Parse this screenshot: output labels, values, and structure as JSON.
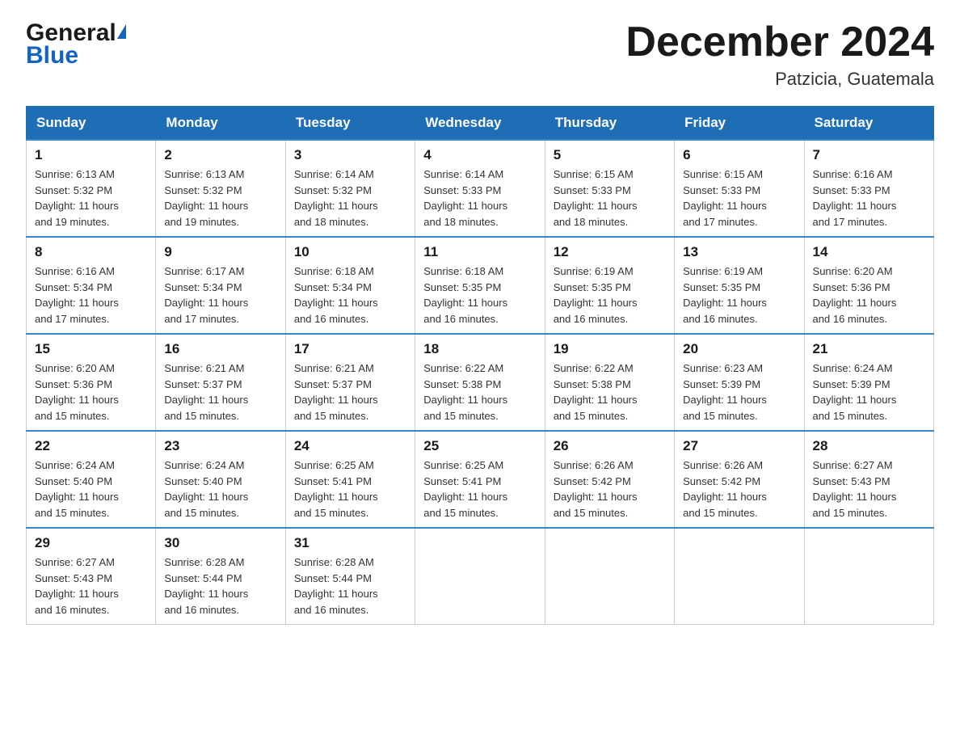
{
  "header": {
    "logo_general": "General",
    "logo_blue": "Blue",
    "month_title": "December 2024",
    "location": "Patzicia, Guatemala"
  },
  "calendar": {
    "days_of_week": [
      "Sunday",
      "Monday",
      "Tuesday",
      "Wednesday",
      "Thursday",
      "Friday",
      "Saturday"
    ],
    "weeks": [
      [
        {
          "day": "1",
          "sunrise": "6:13 AM",
          "sunset": "5:32 PM",
          "daylight": "11 hours and 19 minutes."
        },
        {
          "day": "2",
          "sunrise": "6:13 AM",
          "sunset": "5:32 PM",
          "daylight": "11 hours and 19 minutes."
        },
        {
          "day": "3",
          "sunrise": "6:14 AM",
          "sunset": "5:32 PM",
          "daylight": "11 hours and 18 minutes."
        },
        {
          "day": "4",
          "sunrise": "6:14 AM",
          "sunset": "5:33 PM",
          "daylight": "11 hours and 18 minutes."
        },
        {
          "day": "5",
          "sunrise": "6:15 AM",
          "sunset": "5:33 PM",
          "daylight": "11 hours and 18 minutes."
        },
        {
          "day": "6",
          "sunrise": "6:15 AM",
          "sunset": "5:33 PM",
          "daylight": "11 hours and 17 minutes."
        },
        {
          "day": "7",
          "sunrise": "6:16 AM",
          "sunset": "5:33 PM",
          "daylight": "11 hours and 17 minutes."
        }
      ],
      [
        {
          "day": "8",
          "sunrise": "6:16 AM",
          "sunset": "5:34 PM",
          "daylight": "11 hours and 17 minutes."
        },
        {
          "day": "9",
          "sunrise": "6:17 AM",
          "sunset": "5:34 PM",
          "daylight": "11 hours and 17 minutes."
        },
        {
          "day": "10",
          "sunrise": "6:18 AM",
          "sunset": "5:34 PM",
          "daylight": "11 hours and 16 minutes."
        },
        {
          "day": "11",
          "sunrise": "6:18 AM",
          "sunset": "5:35 PM",
          "daylight": "11 hours and 16 minutes."
        },
        {
          "day": "12",
          "sunrise": "6:19 AM",
          "sunset": "5:35 PM",
          "daylight": "11 hours and 16 minutes."
        },
        {
          "day": "13",
          "sunrise": "6:19 AM",
          "sunset": "5:35 PM",
          "daylight": "11 hours and 16 minutes."
        },
        {
          "day": "14",
          "sunrise": "6:20 AM",
          "sunset": "5:36 PM",
          "daylight": "11 hours and 16 minutes."
        }
      ],
      [
        {
          "day": "15",
          "sunrise": "6:20 AM",
          "sunset": "5:36 PM",
          "daylight": "11 hours and 15 minutes."
        },
        {
          "day": "16",
          "sunrise": "6:21 AM",
          "sunset": "5:37 PM",
          "daylight": "11 hours and 15 minutes."
        },
        {
          "day": "17",
          "sunrise": "6:21 AM",
          "sunset": "5:37 PM",
          "daylight": "11 hours and 15 minutes."
        },
        {
          "day": "18",
          "sunrise": "6:22 AM",
          "sunset": "5:38 PM",
          "daylight": "11 hours and 15 minutes."
        },
        {
          "day": "19",
          "sunrise": "6:22 AM",
          "sunset": "5:38 PM",
          "daylight": "11 hours and 15 minutes."
        },
        {
          "day": "20",
          "sunrise": "6:23 AM",
          "sunset": "5:39 PM",
          "daylight": "11 hours and 15 minutes."
        },
        {
          "day": "21",
          "sunrise": "6:24 AM",
          "sunset": "5:39 PM",
          "daylight": "11 hours and 15 minutes."
        }
      ],
      [
        {
          "day": "22",
          "sunrise": "6:24 AM",
          "sunset": "5:40 PM",
          "daylight": "11 hours and 15 minutes."
        },
        {
          "day": "23",
          "sunrise": "6:24 AM",
          "sunset": "5:40 PM",
          "daylight": "11 hours and 15 minutes."
        },
        {
          "day": "24",
          "sunrise": "6:25 AM",
          "sunset": "5:41 PM",
          "daylight": "11 hours and 15 minutes."
        },
        {
          "day": "25",
          "sunrise": "6:25 AM",
          "sunset": "5:41 PM",
          "daylight": "11 hours and 15 minutes."
        },
        {
          "day": "26",
          "sunrise": "6:26 AM",
          "sunset": "5:42 PM",
          "daylight": "11 hours and 15 minutes."
        },
        {
          "day": "27",
          "sunrise": "6:26 AM",
          "sunset": "5:42 PM",
          "daylight": "11 hours and 15 minutes."
        },
        {
          "day": "28",
          "sunrise": "6:27 AM",
          "sunset": "5:43 PM",
          "daylight": "11 hours and 15 minutes."
        }
      ],
      [
        {
          "day": "29",
          "sunrise": "6:27 AM",
          "sunset": "5:43 PM",
          "daylight": "11 hours and 16 minutes."
        },
        {
          "day": "30",
          "sunrise": "6:28 AM",
          "sunset": "5:44 PM",
          "daylight": "11 hours and 16 minutes."
        },
        {
          "day": "31",
          "sunrise": "6:28 AM",
          "sunset": "5:44 PM",
          "daylight": "11 hours and 16 minutes."
        },
        null,
        null,
        null,
        null
      ]
    ],
    "labels": {
      "sunrise": "Sunrise:",
      "sunset": "Sunset:",
      "daylight": "Daylight:"
    }
  }
}
